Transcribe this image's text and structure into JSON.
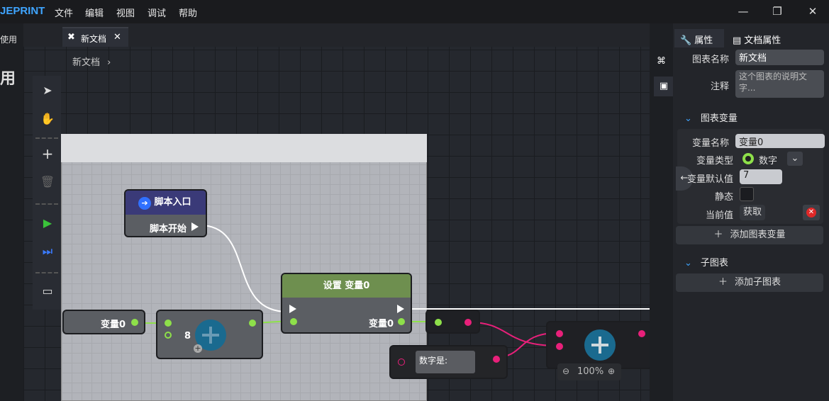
{
  "app": {
    "brand": "JEPRINT"
  },
  "menu": [
    "文件",
    "编辑",
    "视图",
    "调试",
    "帮助"
  ],
  "window": {
    "minimize": "—",
    "restore": "❐",
    "close": "✕"
  },
  "left_panel": {
    "label": "使用",
    "big": "用"
  },
  "tab": {
    "label": "新文档",
    "close": "✕"
  },
  "breadcrumb": {
    "label": "新文档",
    "chevron": "›"
  },
  "nodes": {
    "entry": {
      "title": "脚本入口",
      "out": "脚本开始"
    },
    "set": {
      "title": "设置 变量0",
      "out": "变量0"
    },
    "get": {
      "label": "变量0"
    },
    "add1": {
      "value": "8"
    },
    "text": {
      "label": "数字是:"
    },
    "zoom": "100%"
  },
  "right_strip_icons": [
    "nodes-icon",
    "presentation-icon"
  ],
  "properties": {
    "tabs": [
      "属性",
      "文档属性"
    ],
    "chart_name_label": "图表名称",
    "chart_name": "新文档",
    "note_label": "注释",
    "note_placeholder": "这个图表的说明文字...",
    "vars_section": "图表变量",
    "var_name_label": "变量名称",
    "var_name": "变量0",
    "var_type_label": "变量类型",
    "var_type": "数字",
    "var_default_label": "变量默认值",
    "var_default": "7",
    "static_label": "静态",
    "current_label": "当前值",
    "current_btn": "获取",
    "add_var": "添加图表变量",
    "sub_section": "子图表",
    "add_sub": "添加子图表"
  },
  "colors": {
    "accent": "#3fa5ff",
    "pin_green": "#8ee04a",
    "pin_pink": "#e8207a",
    "node_head_entry": "#3a3a78",
    "node_head_set": "#6e8f4f"
  }
}
